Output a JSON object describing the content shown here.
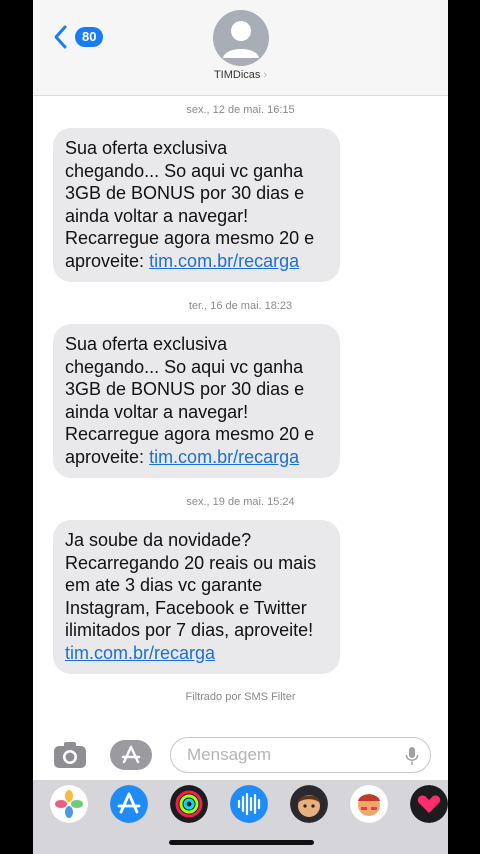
{
  "header": {
    "back_count": "80",
    "contact_name": "TIMDicas"
  },
  "messages": [
    {
      "timestamp": "sex., 12 de mai. 16:15",
      "text": "Sua oferta exclusiva\nchegando... So aqui vc ganha\n3GB de BONUS por 30 dias e\nainda voltar a navegar!\nRecarregue agora mesmo 20 e\naproveite: ",
      "link": "tim.com.br/recarga"
    },
    {
      "timestamp": "ter., 16 de mai. 18:23",
      "text": "Sua oferta exclusiva\nchegando... So aqui vc ganha\n3GB de BONUS por 30 dias e\nainda voltar a navegar!\nRecarregue agora mesmo 20 e\naproveite: ",
      "link": "tim.com.br/recarga"
    },
    {
      "timestamp": "sex., 19 de mai. 15:24",
      "text": "Ja soube da novidade?\nRecarregando 20 reais ou mais\nem ate 3 dias vc garante\nInstagram, Facebook e Twitter\nilimitados por 7 dias, aproveite!\n",
      "link": "tim.com.br/recarga"
    }
  ],
  "filter_note": "Filtrado por SMS Filter",
  "input": {
    "placeholder": "Mensagem"
  },
  "app_drawer": [
    "photos-icon",
    "app-store-icon",
    "activity-icon",
    "audio-message-icon",
    "memoji-icon",
    "memoji-stickers-icon",
    "digital-touch-icon"
  ],
  "colors": {
    "accent": "#1a7cf5",
    "link": "#1a6fd8",
    "bubble": "#e9e9eb"
  }
}
